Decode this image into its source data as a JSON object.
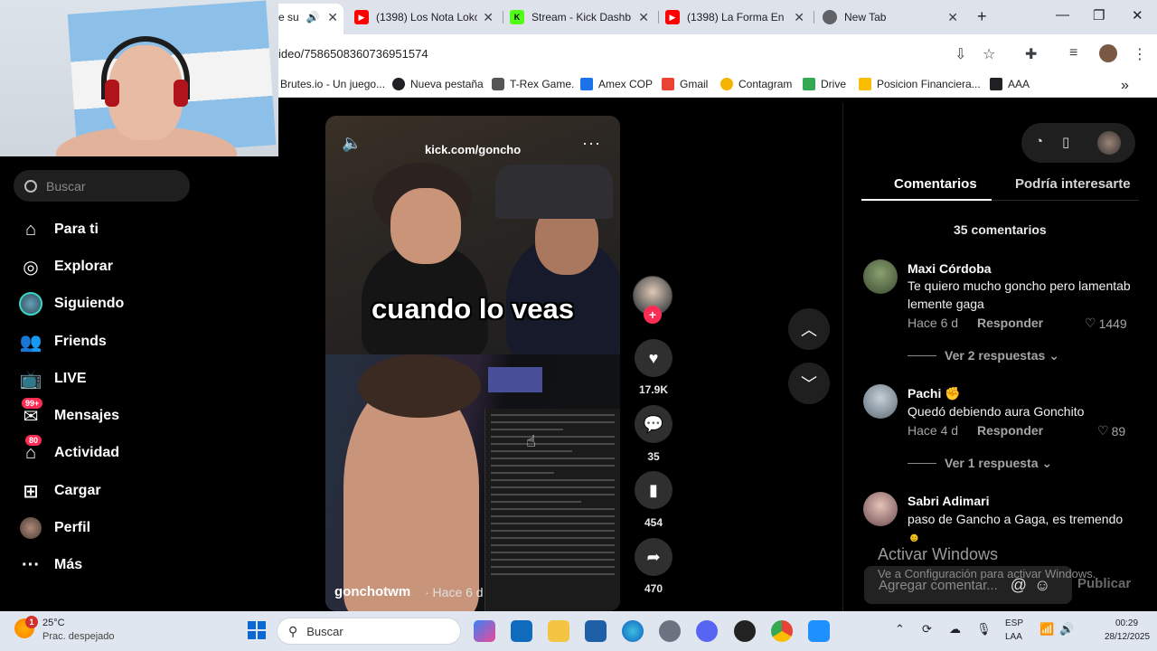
{
  "browser": {
    "tabs": [
      {
        "title": "e su",
        "active": true
      },
      {
        "title": "(1398) Los Nota Loko",
        "icon": "youtube-icon",
        "color": "#ff0000"
      },
      {
        "title": "Stream - Kick Dashbo",
        "icon": "kick-icon",
        "color": "#53fc18"
      },
      {
        "title": "(1398) La Forma En C",
        "icon": "youtube-icon",
        "color": "#ff0000"
      },
      {
        "title": "New Tab",
        "icon": "chrome-icon",
        "color": "#5f6368"
      }
    ],
    "new_tab": "+",
    "url": "ideo/7586508360736951574",
    "bookmarks": [
      "Brutes.io - Un juego...",
      "Nueva pestaña",
      "T-Rex Game.",
      "Amex COP",
      "Gmail",
      "Contagram",
      "Drive",
      "Posicion Financiera...",
      "AAA"
    ],
    "bookmarks_more": "»"
  },
  "sidebar": {
    "search_placeholder": "Buscar",
    "items": [
      {
        "label": "Para ti"
      },
      {
        "label": "Explorar"
      },
      {
        "label": "Siguiendo"
      },
      {
        "label": "Friends"
      },
      {
        "label": "LIVE"
      },
      {
        "label": "Mensajes",
        "badge": "99+"
      },
      {
        "label": "Actividad",
        "badge": "80"
      },
      {
        "label": "Cargar"
      },
      {
        "label": "Perfil"
      },
      {
        "label": "Más"
      }
    ]
  },
  "video": {
    "watermark": "kick.com/goncho",
    "caption": "cuando lo veas",
    "author": "gonchotwm",
    "time": "· Hace 6 d"
  },
  "actions": {
    "likes": "17.9K",
    "comments": "35",
    "saves": "454",
    "shares": "470"
  },
  "panel": {
    "tab_comments": "Comentarios",
    "tab_interest": "Podría interesarte",
    "comments_count": "35 comentarios",
    "comments": [
      {
        "user": "Maxi Córdoba",
        "text": "Te quiero mucho goncho pero lamentab lemente gaga",
        "time": "Hace 6 d",
        "reply": "Responder",
        "likes": "1449",
        "more": "Ver 2 respuestas"
      },
      {
        "user": "Pachi",
        "text": "Quedó debiendo aura Gonchito",
        "time": "Hace 4 d",
        "reply": "Responder",
        "likes": "89",
        "more": "Ver 1 respuesta"
      },
      {
        "user": "Sabri Adimari",
        "text": "paso de Gancho a Gaga, es tremendo"
      }
    ],
    "activate_title": "Activar Windows",
    "activate_sub": "Ve a Configuración para activar Windows.",
    "add_comment_placeholder": "Agregar comentar...",
    "publish": "Publicar"
  },
  "taskbar": {
    "weather_temp": "25°C",
    "weather_desc": "Prac. despejado",
    "weather_badge": "1",
    "search": "Buscar",
    "lang1": "ESP",
    "lang2": "LAA",
    "time": "00:29",
    "date": "28/12/2025"
  }
}
